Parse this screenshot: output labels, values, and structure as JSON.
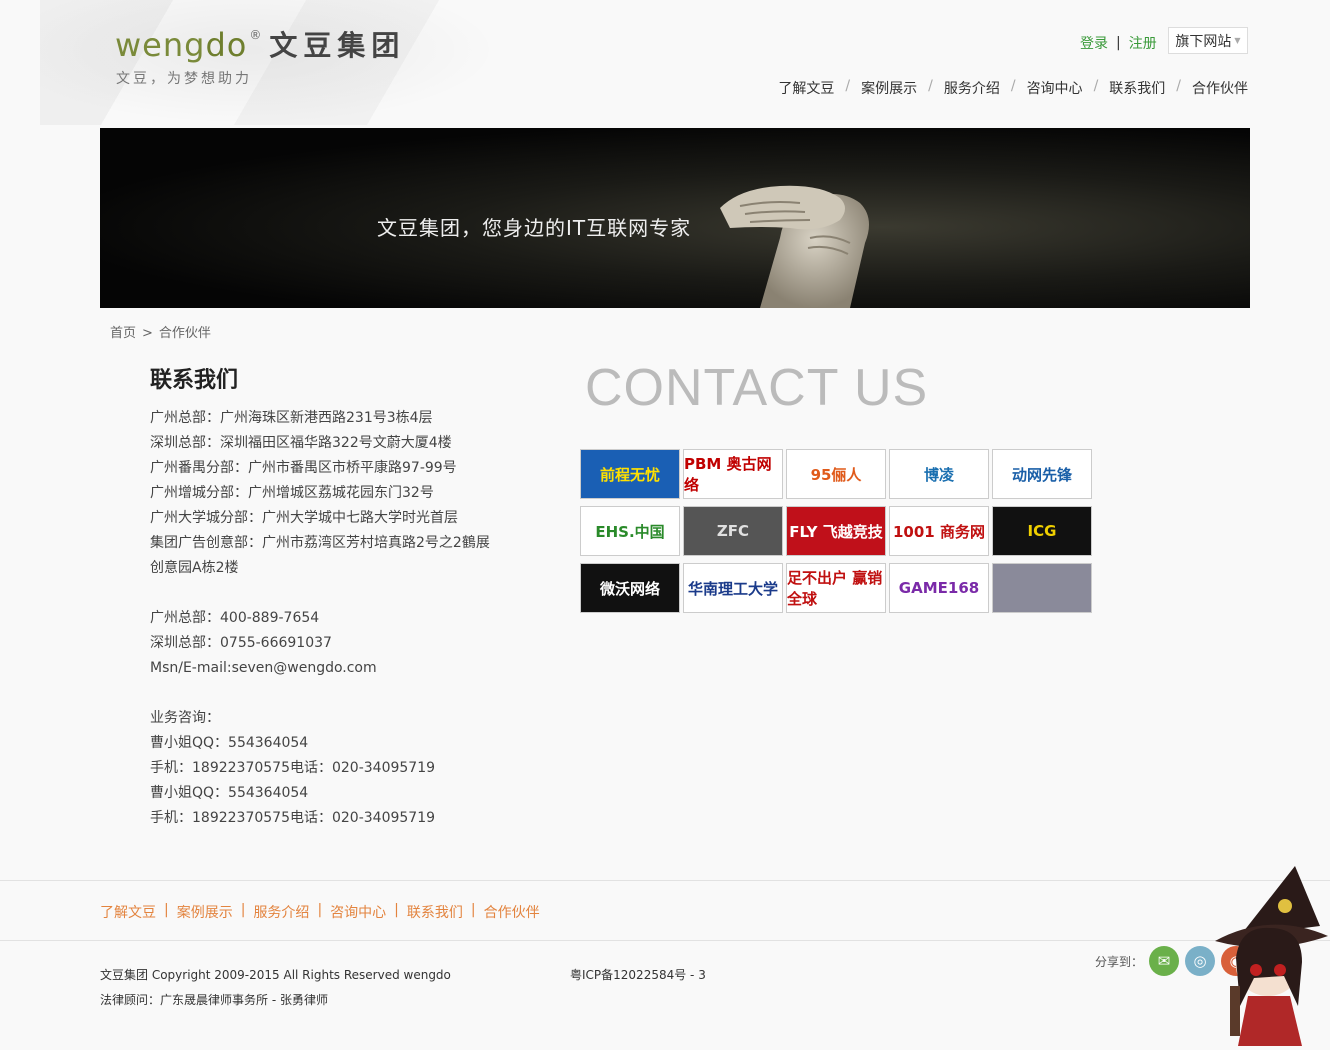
{
  "header": {
    "logo_word_a": "weng",
    "logo_word_b": "do",
    "logo_reg": "®",
    "logo_cn": "文豆集团",
    "tagline": "文豆，为梦想助力",
    "login": "登录",
    "register": "注册",
    "sub_sites": "旗下网站",
    "nav": [
      "了解文豆",
      "案例展示",
      "服务介绍",
      "咨询中心",
      "联系我们",
      "合作伙伴"
    ]
  },
  "banner": {
    "text": "文豆集团，您身边的IT互联网专家"
  },
  "breadcrumb": {
    "home": "首页",
    "current": "合作伙伴"
  },
  "contact": {
    "title": "联系我们",
    "lines": [
      "广州总部：广州海珠区新港西路231号3栋4层",
      "深圳总部：深圳福田区福华路322号文蔚大厦4楼",
      "广州番禺分部：广州市番禺区市桥平康路97-99号",
      "广州增城分部：广州增城区荔城花园东门32号",
      "广州大学城分部：广州大学城中七路大学时光首层",
      "集团广告创意部：广州市荔湾区芳村培真路2号之2鶴展",
      "创意园A栋2楼",
      "",
      "广州总部：400-889-7654",
      "深圳总部：0755-66691037",
      "Msn/E-mail:seven@wengdo.com",
      "",
      "业务咨询：",
      "曹小姐QQ：554364054",
      "手机：18922370575电话：020-34095719",
      "曹小姐QQ：554364054",
      "手机：18922370575电话：020-34095719"
    ],
    "heading_en": "CONTACT US"
  },
  "partners": [
    [
      {
        "name": "前程无忧",
        "bg": "#1a5fb4",
        "fg": "#ffe000"
      },
      {
        "name": "PBM 奥古网络",
        "bg": "#ffffff",
        "fg": "#c00000"
      },
      {
        "name": "95俪人",
        "bg": "#ffffff",
        "fg": "#e05a1a"
      },
      {
        "name": "博凌",
        "bg": "#ffffff",
        "fg": "#1a6fb0"
      },
      {
        "name": "动网先锋",
        "bg": "#ffffff",
        "fg": "#1a5fa8"
      }
    ],
    [
      {
        "name": "EHS.中国",
        "bg": "#ffffff",
        "fg": "#2a8a2a"
      },
      {
        "name": "ZFC",
        "bg": "#555555",
        "fg": "#e0e0e0"
      },
      {
        "name": "FLY 飞越竞技",
        "bg": "#c0101a",
        "fg": "#ffffff"
      },
      {
        "name": "1001 商务网",
        "bg": "#ffffff",
        "fg": "#c01010"
      },
      {
        "name": "ICG",
        "bg": "#111111",
        "fg": "#f0d000"
      }
    ],
    [
      {
        "name": "微沃网络",
        "bg": "#111111",
        "fg": "#ffffff"
      },
      {
        "name": "华南理工大学",
        "bg": "#ffffff",
        "fg": "#1a3a8a"
      },
      {
        "name": "足不出户 赢销全球",
        "bg": "#ffffff",
        "fg": "#c01010"
      },
      {
        "name": "GAME168",
        "bg": "#ffffff",
        "fg": "#7a2aa8"
      },
      {
        "name": "",
        "bg": "#8a8a9a",
        "fg": "#ffffff"
      }
    ]
  ],
  "footer": {
    "nav": [
      "了解文豆",
      "案例展示",
      "服务介绍",
      "咨询中心",
      "联系我们",
      "合作伙伴"
    ],
    "copyright": "文豆集团 Copyright 2009-2015 All Rights Reserved wengdo",
    "icp": "粤ICP备12022584号 - 3",
    "legal": "法律顾问：广东晟晨律师事务所 - 张勇律师",
    "share_label": "分享到："
  },
  "colors": {
    "green_link": "#3a9a3a",
    "footer_orange": "#e3843f",
    "wechat": "#6ab04a",
    "pengyou": "#7ab0c8",
    "weibo": "#d8603a"
  }
}
